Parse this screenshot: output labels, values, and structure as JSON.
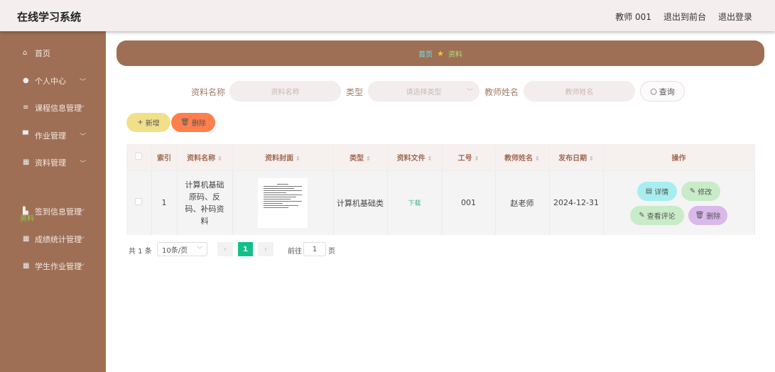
{
  "header": {
    "title": "在线学习系统",
    "user": "教师 001",
    "to_front": "退出到前台",
    "logout": "退出登录"
  },
  "sidebar": {
    "items": [
      {
        "label": "首页",
        "icon": "home-icon"
      },
      {
        "label": "个人中心",
        "icon": "user-icon"
      },
      {
        "label": "课程信息管理",
        "icon": "list-icon"
      },
      {
        "label": "作业管理",
        "icon": "monitor-icon"
      },
      {
        "label": "资料管理",
        "icon": "grid-icon"
      },
      {
        "label": "签到信息管理",
        "icon": "chart-icon"
      },
      {
        "label": "成绩统计管理",
        "icon": "grid-icon"
      },
      {
        "label": "学生作业管理",
        "icon": "grid-icon"
      }
    ],
    "active_sub": "资料"
  },
  "breadcrumb": {
    "home": "首页",
    "current": "资料"
  },
  "search": {
    "name_label": "资料名称",
    "name_placeholder": "资料名称",
    "type_label": "类型",
    "type_placeholder": "请选择类型",
    "teacher_label": "教师姓名",
    "teacher_placeholder": "教师姓名",
    "query": "查询"
  },
  "actions": {
    "add": "新增",
    "delete": "删除"
  },
  "table": {
    "columns": [
      "索引",
      "资料名称",
      "资料封面",
      "类型",
      "资料文件",
      "工号",
      "教师姓名",
      "发布日期",
      "操作"
    ],
    "rows": [
      {
        "index": "1",
        "name": "计算机基础原码、反码、补码资料",
        "type": "计算机基础类",
        "file": "下载",
        "job_no": "001",
        "teacher": "赵老师",
        "date": "2024-12-31",
        "ops": {
          "detail": "详情",
          "edit": "修改",
          "comments": "查看评论",
          "delete": "删除"
        }
      }
    ]
  },
  "pagination": {
    "total": "共 1 条",
    "page_size": "10条/页",
    "current": "1",
    "goto": "前往",
    "goto_value": "1",
    "page_suffix": "页"
  }
}
